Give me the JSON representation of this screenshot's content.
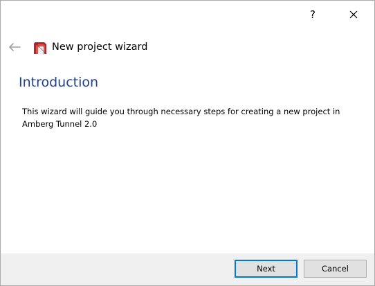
{
  "titlebar": {
    "help_label": "?",
    "close_icon": "close-icon"
  },
  "header": {
    "back_icon": "back-arrow-icon",
    "logo_icon": "app-logo-icon",
    "title": "New project wizard"
  },
  "page": {
    "heading": "Introduction",
    "description": "This wizard will guide you through necessary steps for creating a new project in Amberg Tunnel 2.0"
  },
  "footer": {
    "next_label": "Next",
    "cancel_label": "Cancel"
  },
  "colors": {
    "heading": "#1e3f8a",
    "footer_background": "#f0f0f0",
    "default_button_border": "#0078d7",
    "logo_red": "#b3262b"
  }
}
